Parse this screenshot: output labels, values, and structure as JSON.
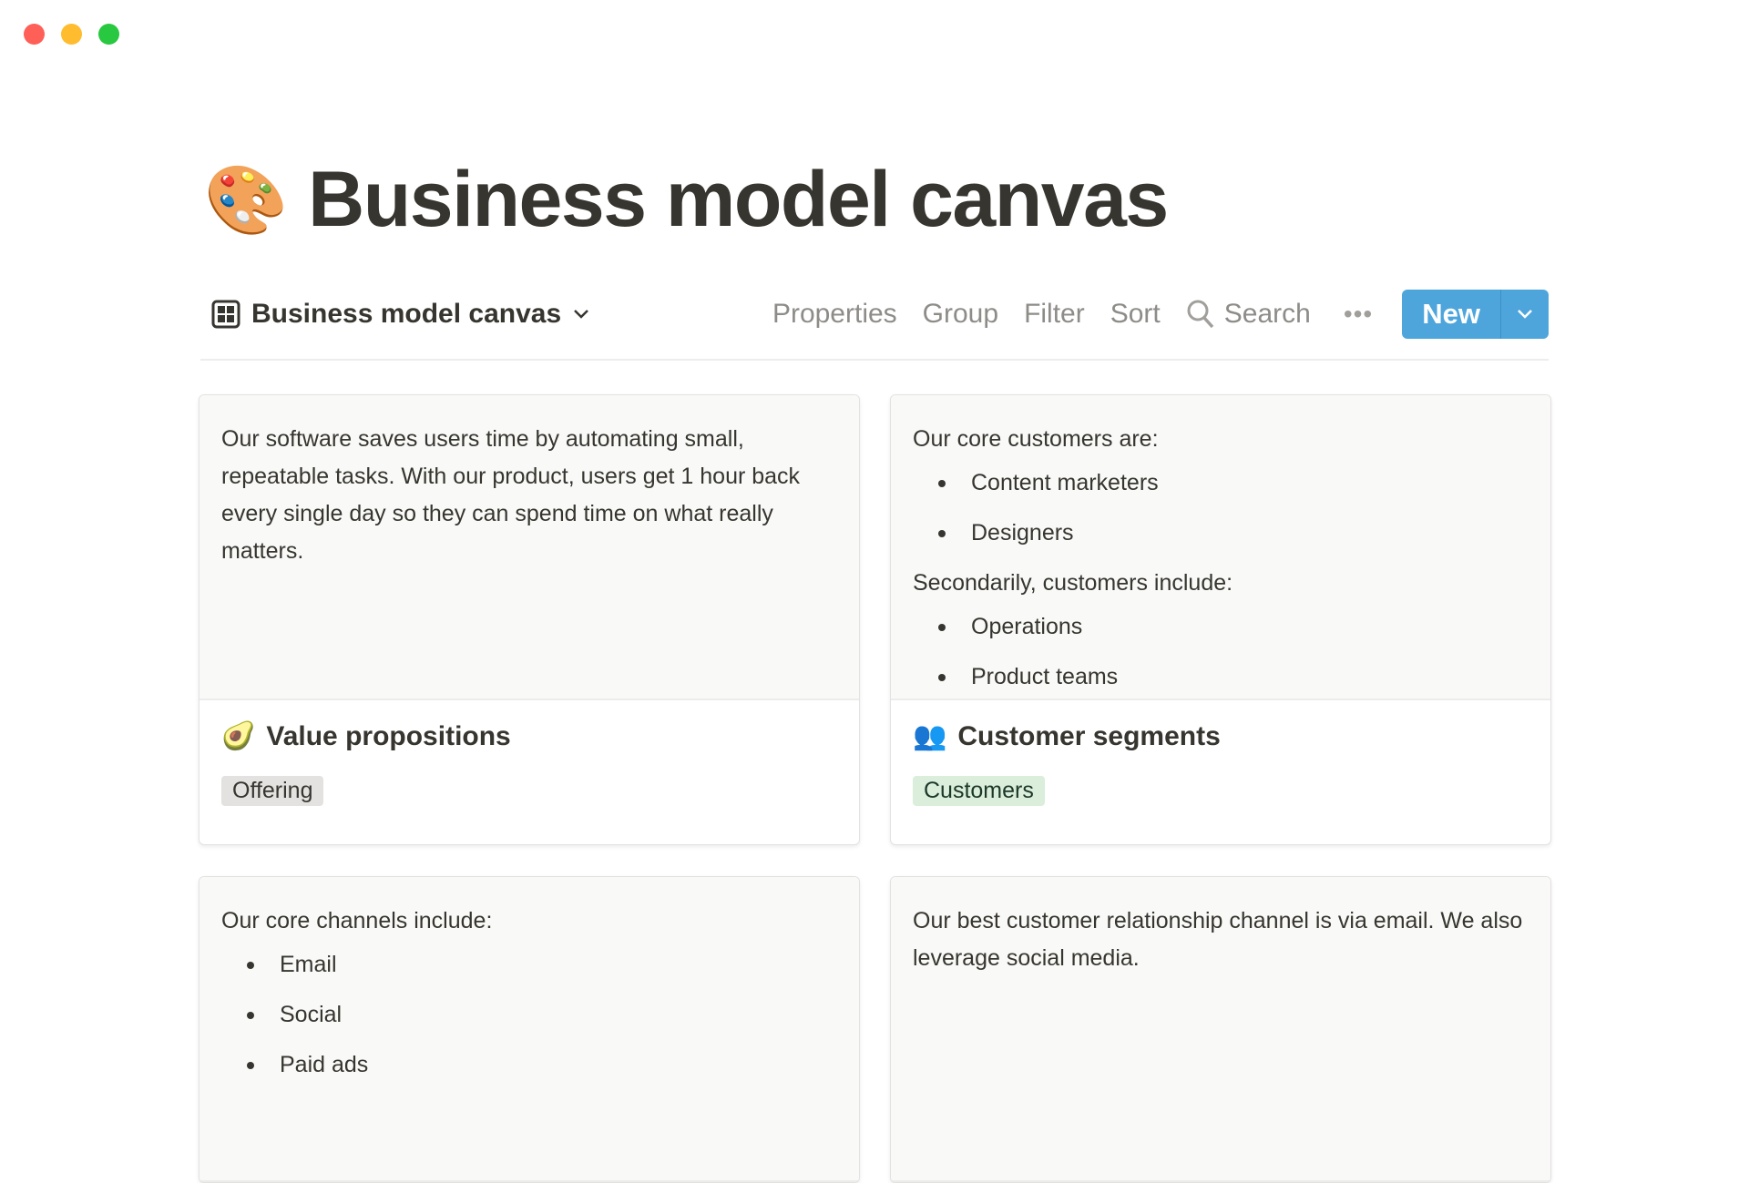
{
  "window": {
    "lights": [
      "#fe5f57",
      "#febc2e",
      "#28c840"
    ]
  },
  "page": {
    "icon": "🎨",
    "title": "Business model canvas"
  },
  "toolbar": {
    "view_name": "Business model canvas",
    "properties": "Properties",
    "group": "Group",
    "filter": "Filter",
    "sort": "Sort",
    "search": "Search",
    "more": "•••",
    "new": "New"
  },
  "cards": [
    {
      "text": "Our software saves users time by automating small, repeatable tasks. With our product, users get 1 hour back every single day so they can spend time on what really matters.",
      "icon": "🥑",
      "title": "Value propositions",
      "tag": "Offering",
      "tag_bg": "#e3e2e0"
    },
    {
      "intro": "Our core customers are:",
      "list1": [
        "Content marketers",
        "Designers"
      ],
      "intro2": "Secondarily, customers include:",
      "list2": [
        "Operations",
        "Product teams"
      ],
      "icon": "👥",
      "title": "Customer segments",
      "tag": "Customers",
      "tag_bg": "#dbeddb"
    },
    {
      "intro": "Our core channels include:",
      "list1": [
        "Email",
        "Social",
        "Paid ads"
      ]
    },
    {
      "text": "Our best customer relationship channel is via email. We also leverage social media."
    }
  ]
}
